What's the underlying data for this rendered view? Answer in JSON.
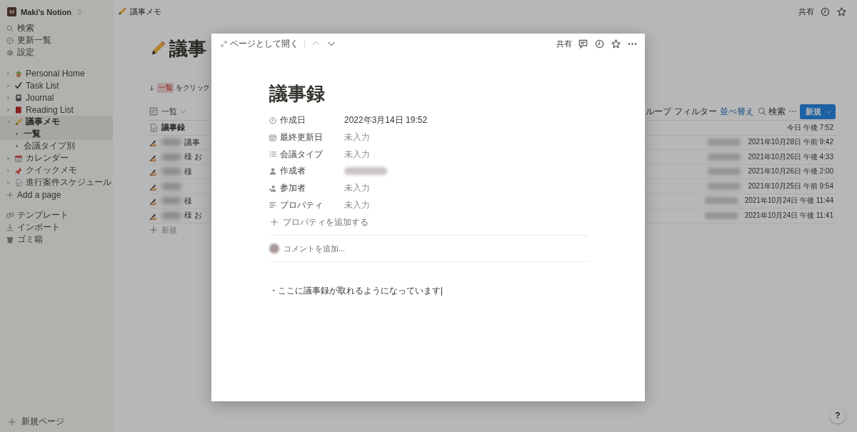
{
  "sidebar": {
    "workspace": {
      "initial": "M",
      "name": "Maki's Notion"
    },
    "actions": [
      {
        "label": "検索"
      },
      {
        "label": "更新一覧"
      },
      {
        "label": "設定"
      }
    ],
    "pages": [
      {
        "label": "Personal Home",
        "expanded": false,
        "selected": false
      },
      {
        "label": "Task List",
        "expanded": false,
        "selected": false
      },
      {
        "label": "Journal",
        "expanded": false,
        "selected": false
      },
      {
        "label": "Reading List",
        "expanded": false,
        "selected": false
      },
      {
        "label": "議事メモ",
        "expanded": true,
        "selected": true,
        "children": [
          {
            "label": "一覧",
            "selected": true
          },
          {
            "label": "会議タイプ別",
            "selected": false
          }
        ]
      },
      {
        "label": "カレンダー",
        "expanded": false,
        "selected": false
      },
      {
        "label": "クイックメモ",
        "expanded": false,
        "selected": false
      },
      {
        "label": "進行案件スケジュール",
        "expanded": false,
        "selected": false
      }
    ],
    "add_page": "Add a page",
    "footer": [
      {
        "label": "テンプレート"
      },
      {
        "label": "インポート"
      },
      {
        "label": "ゴミ箱"
      }
    ],
    "new_page": "新規ページ"
  },
  "topbar": {
    "breadcrumb": "議事メモ",
    "share": "共有"
  },
  "page": {
    "title": "議事",
    "hint_tag": "一覧",
    "hint_text": "をクリック",
    "view": "一覧",
    "toolbar": [
      {
        "label": "ループ",
        "kind": "plain"
      },
      {
        "label": "フィルター",
        "kind": "plain"
      },
      {
        "label": "並べ替え",
        "kind": "active"
      },
      {
        "label": "検索",
        "kind": "search"
      }
    ],
    "new_button": "新規",
    "rows": [
      {
        "kind": "doc",
        "title": "議事録",
        "date": "今日 午後 7:52"
      },
      {
        "kind": "pen",
        "title": "議事",
        "date": "2021年10月28日 午前 9:42"
      },
      {
        "kind": "pen",
        "title": "様 お",
        "date": "2021年10月26日 午後 4:33"
      },
      {
        "kind": "pen",
        "title": "様",
        "date": "2021年10月26日 午後 2:00"
      },
      {
        "kind": "pen",
        "date": "2021年10月25日 午前 9:54"
      },
      {
        "kind": "pen",
        "title": "様",
        "date": "2021年10月24日 午後 11:44"
      },
      {
        "kind": "pen",
        "title": "様 お",
        "date": "2021年10月24日 午後 11:41"
      }
    ],
    "add_row": "新規"
  },
  "modal": {
    "open_as_page": "ページとして開く",
    "share": "共有",
    "title": "議事録",
    "properties": [
      {
        "label": "作成日",
        "value": "2022年3月14日 19:52",
        "empty": false
      },
      {
        "label": "最終更新日",
        "value": "未入力",
        "empty": true
      },
      {
        "label": "会議タイプ",
        "value": "未入力",
        "empty": true
      },
      {
        "label": "作成者",
        "kind": "person"
      },
      {
        "label": "参加者",
        "value": "未入力",
        "empty": true
      },
      {
        "label": "プロパティ",
        "value": "未入力",
        "empty": true
      }
    ],
    "add_property": "プロパティを追加する",
    "comment_placeholder": "コメントを追加...",
    "body": "・ここに議事録が取れるようになっています"
  },
  "help": "?"
}
